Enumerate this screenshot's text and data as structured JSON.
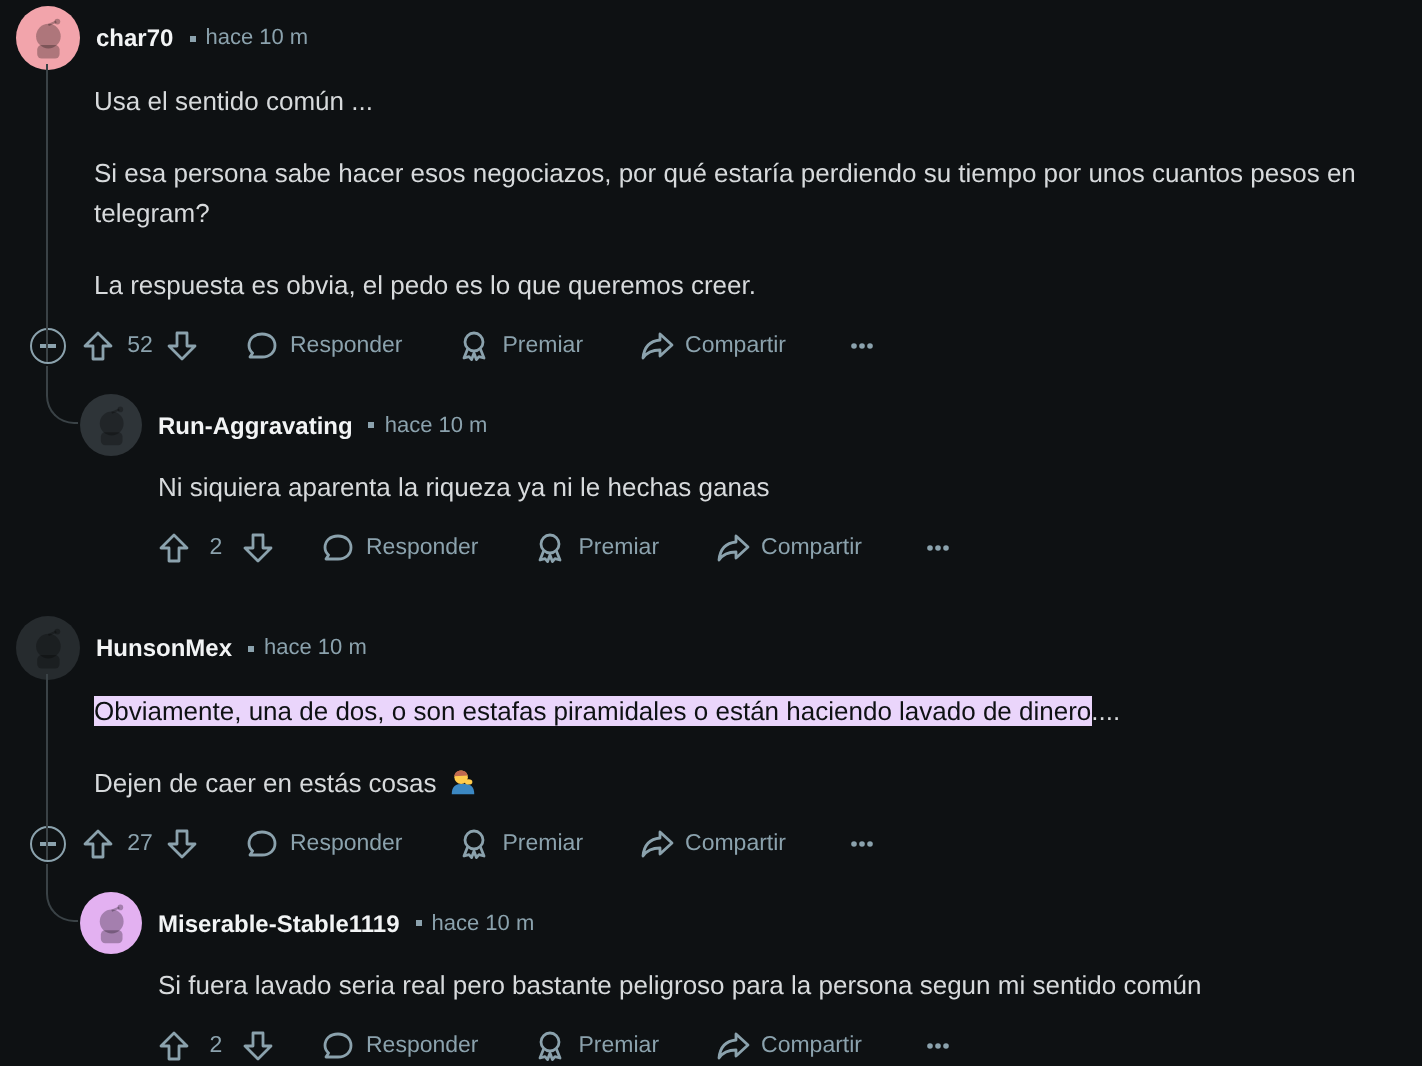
{
  "comments": [
    {
      "author": "char70",
      "time": "hace 10 m",
      "color": "#f2a4ab",
      "paragraphs": [
        [
          {
            "text": "Usa el sentido común ...",
            "selected": false
          }
        ],
        [
          {
            "text": "Si esa persona sabe hacer esos negociazos, por qué estaría perdiendo su tiempo por unos cuantos pesos en telegram?",
            "selected": false
          }
        ],
        [
          {
            "text": "La respuesta es obvia, el pedo es lo que queremos creer.",
            "selected": false
          }
        ]
      ],
      "votes": "52",
      "actions": [
        "Responder",
        "Premiar",
        "Compartir"
      ],
      "children": [
        {
          "author": "Run-Aggravating",
          "time": "hace 10 m",
          "color": "#2e3438",
          "paragraphs": [
            [
              {
                "text": "Ni siquiera aparenta la riqueza ya ni le hechas ganas",
                "selected": false
              }
            ]
          ],
          "votes": "2",
          "actions": [
            "Responder",
            "Premiar",
            "Compartir"
          ]
        }
      ]
    },
    {
      "author": "HunsonMex",
      "time": "hace 10 m",
      "color": "#262b2e",
      "paragraphs": [
        [
          {
            "text": "Obviamente, una de dos, o son estafas piramidales o están haciendo lavado de dinero",
            "selected": true
          },
          {
            "text": "....",
            "selected": false
          }
        ],
        [
          {
            "text": "Dejen de caer en estás cosas",
            "selected": false
          }
        ]
      ],
      "votes": "27",
      "actions": [
        "Responder",
        "Premiar",
        "Compartir"
      ],
      "children": [
        {
          "author": "Miserable-Stable1119",
          "time": "hace 10 m",
          "color": "#e3b1f1",
          "paragraphs": [
            [
              {
                "text": "Si fuera lavado seria real pero bastante peligroso para la persona segun mi sentido común",
                "selected": false
              }
            ]
          ],
          "votes": "2",
          "actions": [
            "Responder",
            "Premiar",
            "Compartir"
          ]
        }
      ]
    }
  ]
}
